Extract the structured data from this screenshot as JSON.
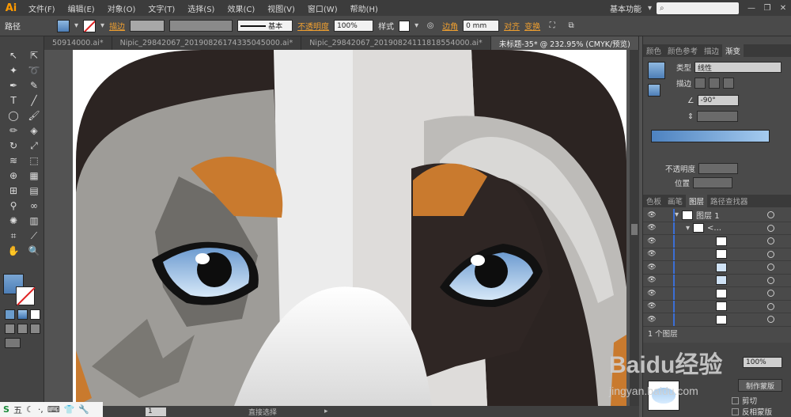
{
  "app": {
    "logo": "Ai"
  },
  "menu": [
    "文件(F)",
    "编辑(E)",
    "对象(O)",
    "文字(T)",
    "选择(S)",
    "效果(C)",
    "视图(V)",
    "窗口(W)",
    "帮助(H)"
  ],
  "workspace": "基本功能",
  "control": {
    "object_type": "路径",
    "stroke_label": "描边",
    "stroke_style": "基本",
    "opacity_label": "不透明度",
    "opacity_value": "100%",
    "style_label": "样式",
    "radius_label": "边角",
    "radius_value": "0 mm",
    "align_label": "对齐",
    "transform_label": "变换"
  },
  "tabs": [
    {
      "label": "50914000.ai*",
      "active": false
    },
    {
      "label": "Nipic_29842067_20190826174335045000.ai*",
      "active": false
    },
    {
      "label": "Nipic_29842067_20190824111818554000.ai*",
      "active": false
    },
    {
      "label": "未标题-35* @ 232.95% (CMYK/预览)",
      "active": true
    }
  ],
  "gradient_panel": {
    "tabs": [
      "颜色",
      "颜色参考",
      "描边",
      "渐变"
    ],
    "type_label": "类型",
    "type_value": "线性",
    "stroke_label": "描边",
    "angle_value": "-90°",
    "opacity_label": "不透明度",
    "position_label": "位置"
  },
  "layers_panel": {
    "tabs": [
      "色板",
      "画笔",
      "图层",
      "路径查找器"
    ],
    "layer_name": "图层 1",
    "sublayer_name": "<...",
    "footer_count": "1 个图层"
  },
  "transparency_panel": {
    "opacity_value": "100%",
    "make_mask": "制作蒙版",
    "clip": "剪切",
    "invert_mask": "反相蒙版"
  },
  "status": {
    "tool": "直接选择",
    "page": "1"
  },
  "watermark": {
    "brand": "Baidu经验",
    "url": "jingyan.baidu.com"
  },
  "taskbar": {
    "ime": "五"
  },
  "colors": {
    "accent_blue": "#4d82c0",
    "orange": "#c97a2e",
    "dark_brown": "#2e2523"
  }
}
